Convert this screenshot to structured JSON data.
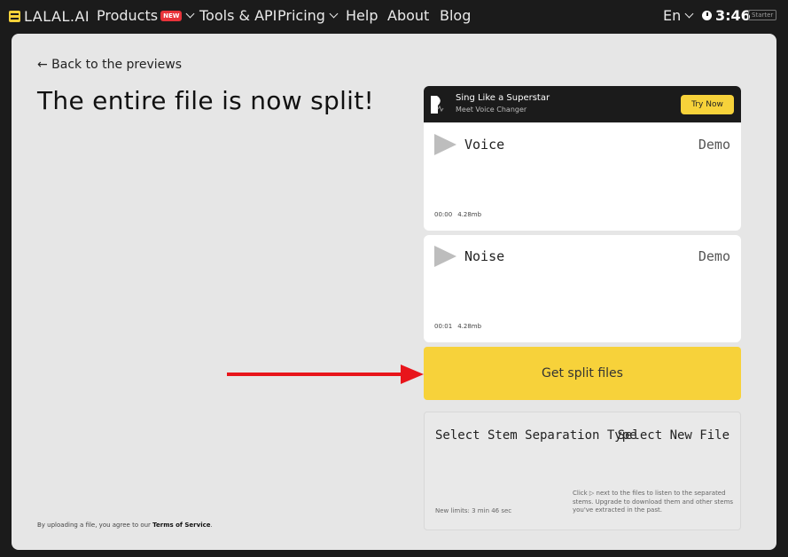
{
  "nav": {
    "logo": "LALAL.AI",
    "items": [
      {
        "label": "Products",
        "badge": "NEW",
        "dropdown": true
      },
      {
        "label": "Tools & API"
      },
      {
        "label": "Pricing",
        "dropdown": true
      },
      {
        "label": "Help"
      },
      {
        "label": "About"
      },
      {
        "label": "Blog"
      }
    ],
    "language": "En",
    "timer": "3:46",
    "plan": "Starter"
  },
  "main": {
    "back_link": "← Back to the previews",
    "title": "The entire file is now split!",
    "terms_prefix": "By uploading a file, you agree to our ",
    "terms_link": "Terms of Service",
    "terms_suffix": "."
  },
  "promo": {
    "title": "Sing Like a Superstar",
    "subtitle": "Meet Voice Changer",
    "button": "Try Now"
  },
  "stems": [
    {
      "name": "Voice",
      "demo": "Demo",
      "time": "00:00",
      "size": "4.28mb"
    },
    {
      "name": "Noise",
      "demo": "Demo",
      "time": "00:01",
      "size": "4.28mb"
    }
  ],
  "actions": {
    "get_split_files": "Get split files",
    "select_type": "Select Stem Separation Type",
    "select_new": "Select New File",
    "limits": "New limits: 3 min 46 sec",
    "hint": "Click ▷ next to the files to listen to the separated stems. Upgrade to download them and other stems you've extracted in the past."
  },
  "colors": {
    "accent": "#f7d23a",
    "arrow": "#e8151b",
    "nav_bg": "#1b1b1b",
    "panel_bg": "#e6e6e6"
  }
}
